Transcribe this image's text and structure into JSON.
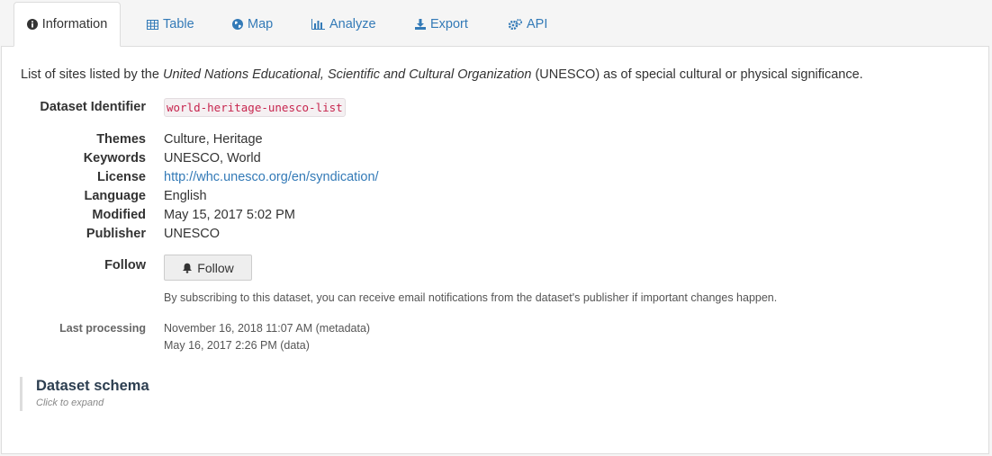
{
  "tabs": [
    {
      "label": "Information",
      "icon": "info-circle-icon",
      "active": true
    },
    {
      "label": "Table",
      "icon": "table-icon",
      "active": false
    },
    {
      "label": "Map",
      "icon": "globe-icon",
      "active": false
    },
    {
      "label": "Analyze",
      "icon": "bar-chart-icon",
      "active": false
    },
    {
      "label": "Export",
      "icon": "download-icon",
      "active": false
    },
    {
      "label": "API",
      "icon": "gears-icon",
      "active": false
    }
  ],
  "description": {
    "prefix": "List of sites listed by the ",
    "org": "United Nations Educational, Scientific and Cultural Organization",
    "suffix": " (UNESCO) as of special cultural or physical significance."
  },
  "identifier": {
    "label": "Dataset Identifier",
    "value": "world-heritage-unesco-list"
  },
  "metadata": {
    "themes": {
      "label": "Themes",
      "value": "Culture, Heritage"
    },
    "keywords": {
      "label": "Keywords",
      "value": "UNESCO, World"
    },
    "license": {
      "label": "License",
      "value": "http://whc.unesco.org/en/syndication/"
    },
    "language": {
      "label": "Language",
      "value": "English"
    },
    "modified": {
      "label": "Modified",
      "value": "May 15, 2017 5:02 PM"
    },
    "publisher": {
      "label": "Publisher",
      "value": "UNESCO"
    }
  },
  "follow": {
    "label": "Follow",
    "button_label": "Follow",
    "note": "By subscribing to this dataset, you can receive email notifications from the dataset's publisher if important changes happen."
  },
  "processing": {
    "label": "Last processing",
    "metadata": "November 16, 2018 11:07 AM (metadata)",
    "data": "May 16, 2017 2:26 PM (data)"
  },
  "schema": {
    "title": "Dataset schema",
    "subtitle": "Click to expand"
  },
  "colors": {
    "link": "#337ab7",
    "code_text": "#c7254e",
    "schema_title": "#2c3e50"
  }
}
